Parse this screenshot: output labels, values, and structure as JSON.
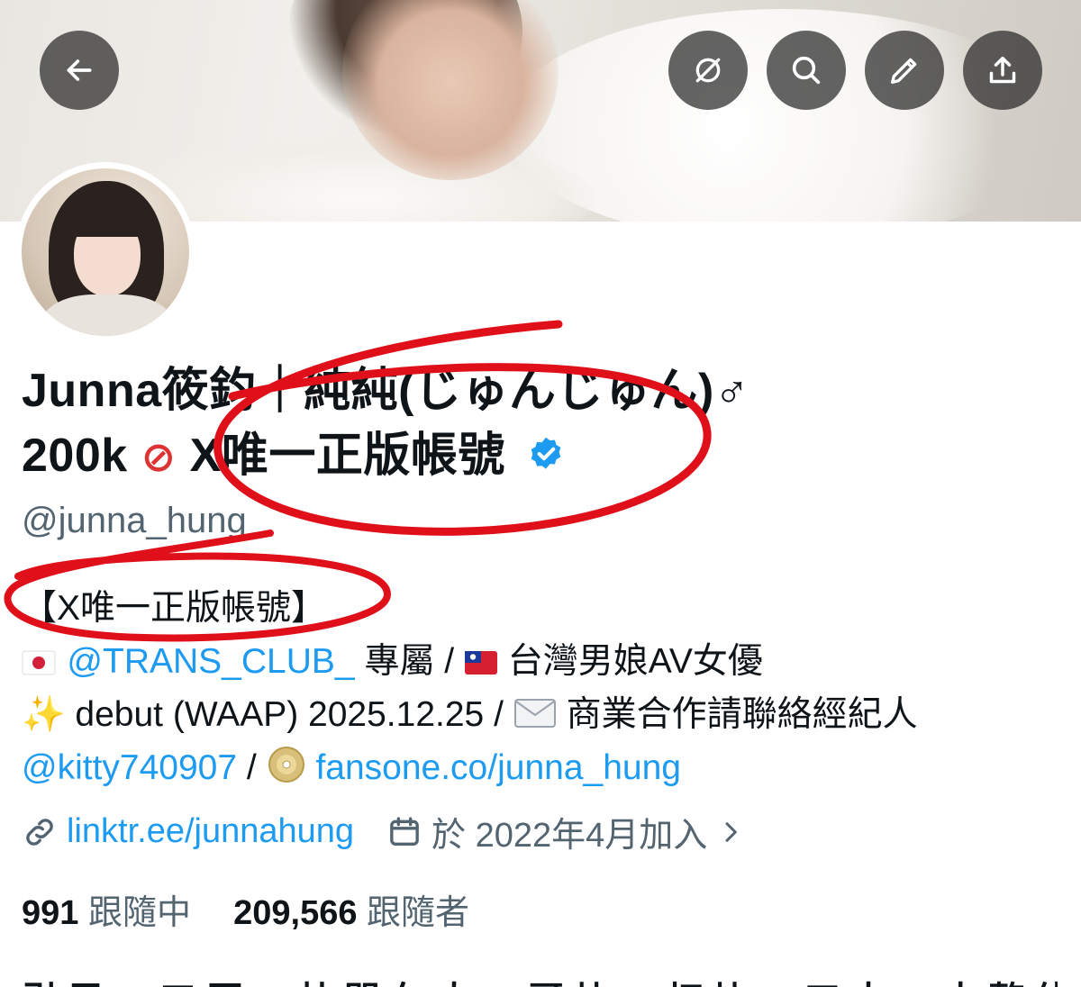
{
  "profile": {
    "name_line1": "Junna筱鈞｜純純(じゅんじゅん)♂",
    "name_line2_prefix": "200k",
    "name_line2_suffix": "X唯一正版帳號",
    "handle": "@junna_hung"
  },
  "bio": {
    "line1": "【X唯一正版帳號】",
    "line2_mention": "@TRANS_CLUB_",
    "line2_text": "專屬 / ",
    "line2_text2": "台灣男娘AV女優",
    "line3_text": "debut (WAAP) 2025.12.25 / ",
    "line3_text2": "商業合作請聯絡經紀人",
    "line4_mention": "@kitty740907",
    "line4_sep": " / ",
    "line4_link": "fansone.co/junna_hung"
  },
  "meta": {
    "website": "linktr.ee/junnahung",
    "joined": "於 2022年4月加入"
  },
  "stats": {
    "following_count": "991",
    "following_label": "跟隨中",
    "followers_count": "209,566",
    "followers_label": "跟隨者"
  },
  "cutoff_text": "引 亏 一 工 压 一 杜 閃 久 大 一 哥 块 一 打 块 一 工 大 一 本 整 体 久 大",
  "icons": {
    "back": "arrow-left-icon",
    "grok": "slash-circle-icon",
    "search": "search-icon",
    "edit": "pencil-icon",
    "share": "share-icon",
    "verified": "verified-badge-icon",
    "link": "link-icon",
    "calendar": "calendar-icon",
    "chevron": "chevron-right-icon"
  },
  "colors": {
    "link": "#1d9bf0",
    "muted": "#536471",
    "annotation": "#e0101a"
  }
}
